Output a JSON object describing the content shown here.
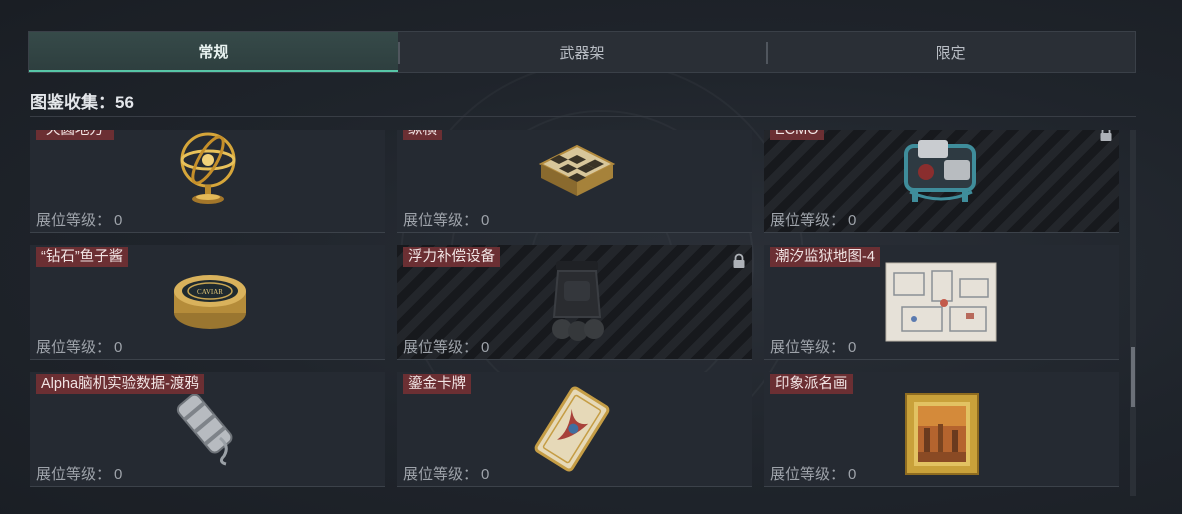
{
  "tabs": [
    {
      "label": "常规",
      "active": true
    },
    {
      "label": "武器架",
      "active": false
    },
    {
      "label": "限定",
      "active": false
    }
  ],
  "collection": {
    "label": "图鉴收集：",
    "count": "56"
  },
  "level_label": "展位等级：",
  "items": [
    {
      "name": "“天圆地方”",
      "level": "0",
      "locked": false,
      "icon": "armillary-sphere-icon"
    },
    {
      "name": "纵横",
      "level": "0",
      "locked": false,
      "icon": "chessboard-icon"
    },
    {
      "name": "ECMO",
      "level": "0",
      "locked": true,
      "icon": "ecmo-machine-icon"
    },
    {
      "name": "“钻石”鱼子酱",
      "level": "0",
      "locked": false,
      "icon": "caviar-tin-icon",
      "tin_text": "CAVIAR"
    },
    {
      "name": "浮力补偿设备",
      "level": "0",
      "locked": true,
      "icon": "buoyancy-device-icon"
    },
    {
      "name": "潮汐监狱地图-4",
      "level": "0",
      "locked": false,
      "icon": "map-icon"
    },
    {
      "name": "Alpha脑机实验数据-渡鸦",
      "level": "0",
      "locked": false,
      "icon": "data-canister-icon"
    },
    {
      "name": "鎏金卡牌",
      "level": "0",
      "locked": false,
      "icon": "gilded-card-icon"
    },
    {
      "name": "印象派名画",
      "level": "0",
      "locked": false,
      "icon": "painting-icon"
    }
  ],
  "colors": {
    "accent": "#57c6a7",
    "name_tag": "#6b2f33",
    "card_bg": "#252a32"
  }
}
